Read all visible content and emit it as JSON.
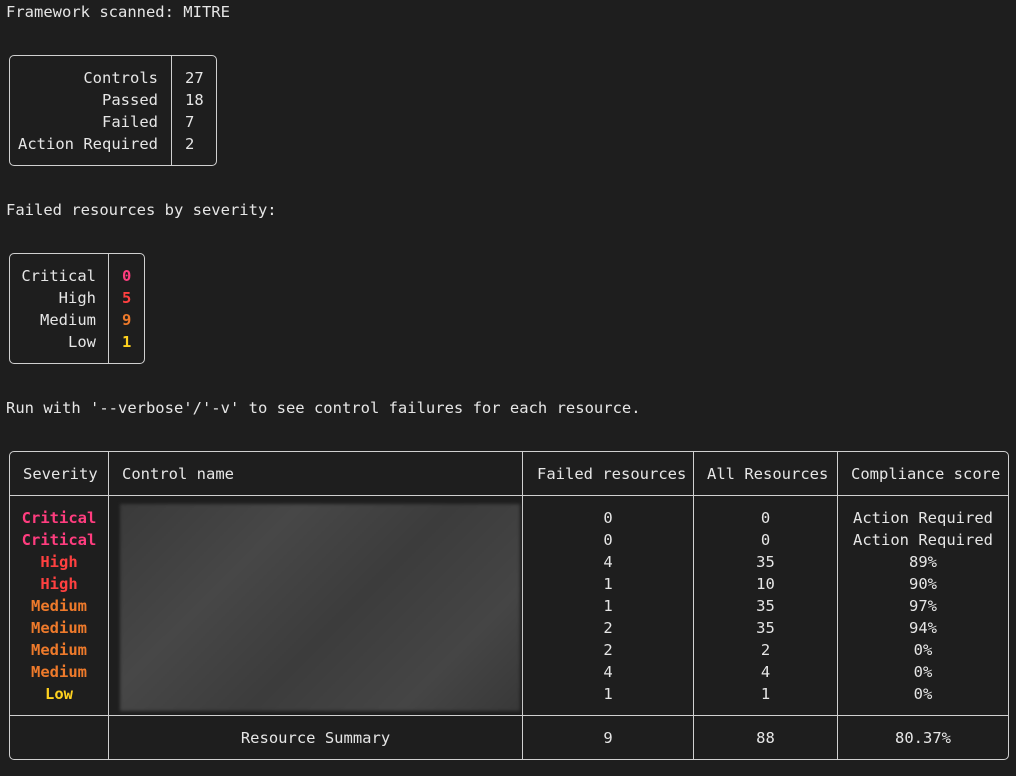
{
  "header": {
    "framework_line": "Framework scanned: MITRE"
  },
  "summary": {
    "rows": [
      {
        "label": "Controls",
        "value": "27"
      },
      {
        "label": "Passed",
        "value": "18"
      },
      {
        "label": "Failed",
        "value": "7"
      },
      {
        "label": "Action Required",
        "value": "2"
      }
    ]
  },
  "severity_section": {
    "title": "Failed resources by severity:",
    "rows": [
      {
        "label": "Critical",
        "value": "0",
        "color": "#ff3d7f"
      },
      {
        "label": "High",
        "value": "5",
        "color": "#ff4040"
      },
      {
        "label": "Medium",
        "value": "9",
        "color": "#ee7a2b"
      },
      {
        "label": "Low",
        "value": "1",
        "color": "#ffd21f"
      }
    ]
  },
  "hint": "Run with '--verbose'/'-v' to see control failures for each resource.",
  "results_table": {
    "headers": {
      "severity": "Severity",
      "control": "Control name",
      "failed": "Failed resources",
      "all": "All Resources",
      "score": "Compliance score"
    },
    "rows": [
      {
        "severity": "Critical",
        "color": "#ff3d7f",
        "failed": "0",
        "all": "0",
        "score": "Action Required"
      },
      {
        "severity": "Critical",
        "color": "#ff3d7f",
        "failed": "0",
        "all": "0",
        "score": "Action Required"
      },
      {
        "severity": "High",
        "color": "#ff4040",
        "failed": "4",
        "all": "35",
        "score": "89%"
      },
      {
        "severity": "High",
        "color": "#ff4040",
        "failed": "1",
        "all": "10",
        "score": "90%"
      },
      {
        "severity": "Medium",
        "color": "#ee7a2b",
        "failed": "1",
        "all": "35",
        "score": "97%"
      },
      {
        "severity": "Medium",
        "color": "#ee7a2b",
        "failed": "2",
        "all": "35",
        "score": "94%"
      },
      {
        "severity": "Medium",
        "color": "#ee7a2b",
        "failed": "2",
        "all": "2",
        "score": "0%"
      },
      {
        "severity": "Medium",
        "color": "#ee7a2b",
        "failed": "4",
        "all": "4",
        "score": "0%"
      },
      {
        "severity": "Low",
        "color": "#ffd21f",
        "failed": "1",
        "all": "1",
        "score": "0%"
      }
    ],
    "footer": {
      "label": "Resource Summary",
      "failed": "9",
      "all": "88",
      "score": "80.37%"
    }
  }
}
